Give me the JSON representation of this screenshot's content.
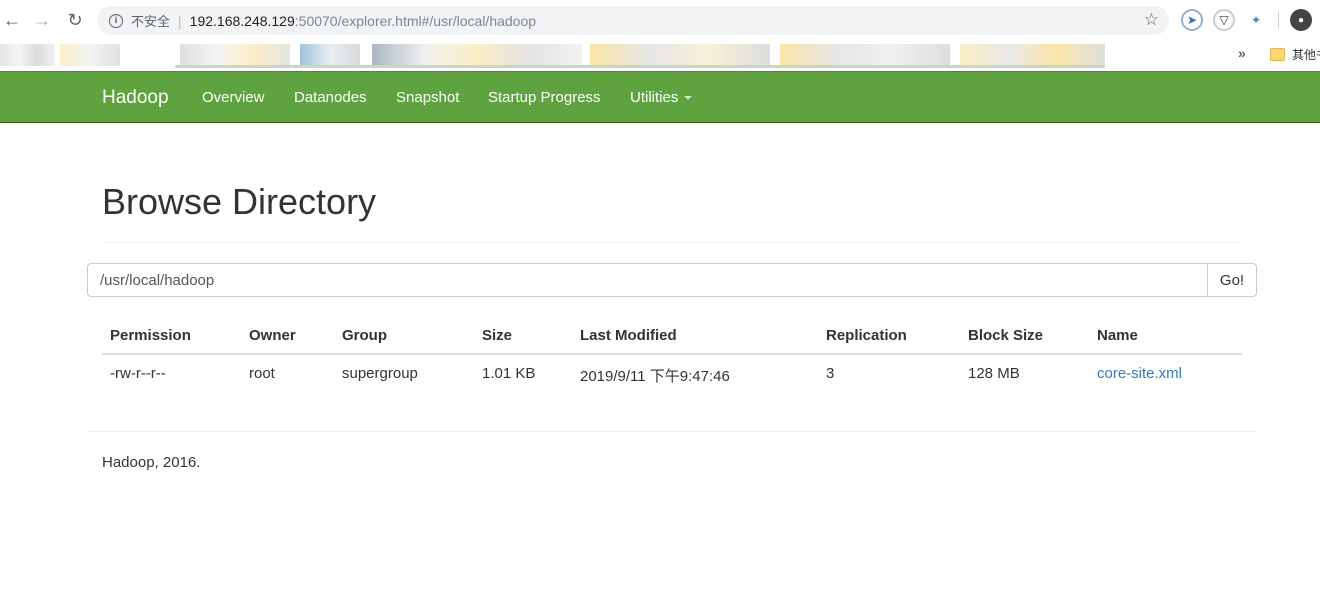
{
  "browser": {
    "address": {
      "security_label": "不安全",
      "separator": "|",
      "host": "192.168.248.129",
      "rest": ":50070/explorer.html#/usr/local/hadoop"
    },
    "bookmarks": {
      "more": "»",
      "other_label": "其他书签"
    }
  },
  "navbar": {
    "brand": "Hadoop",
    "links": [
      "Overview",
      "Datanodes",
      "Snapshot",
      "Startup Progress",
      "Utilities"
    ],
    "color": "#5fa341"
  },
  "page": {
    "title": "Browse Directory",
    "path_value": "/usr/local/hadoop",
    "go_label": "Go!"
  },
  "table": {
    "headers": [
      "Permission",
      "Owner",
      "Group",
      "Size",
      "Last Modified",
      "Replication",
      "Block Size",
      "Name"
    ],
    "rows": [
      [
        "-rw-r--r--",
        "root",
        "supergroup",
        "1.01 KB",
        "2019/9/11 下午9:47:46",
        "3",
        "128 MB",
        "core-site.xml"
      ]
    ],
    "link_color": "#337ab7"
  },
  "footer": {
    "text": "Hadoop, 2016."
  }
}
